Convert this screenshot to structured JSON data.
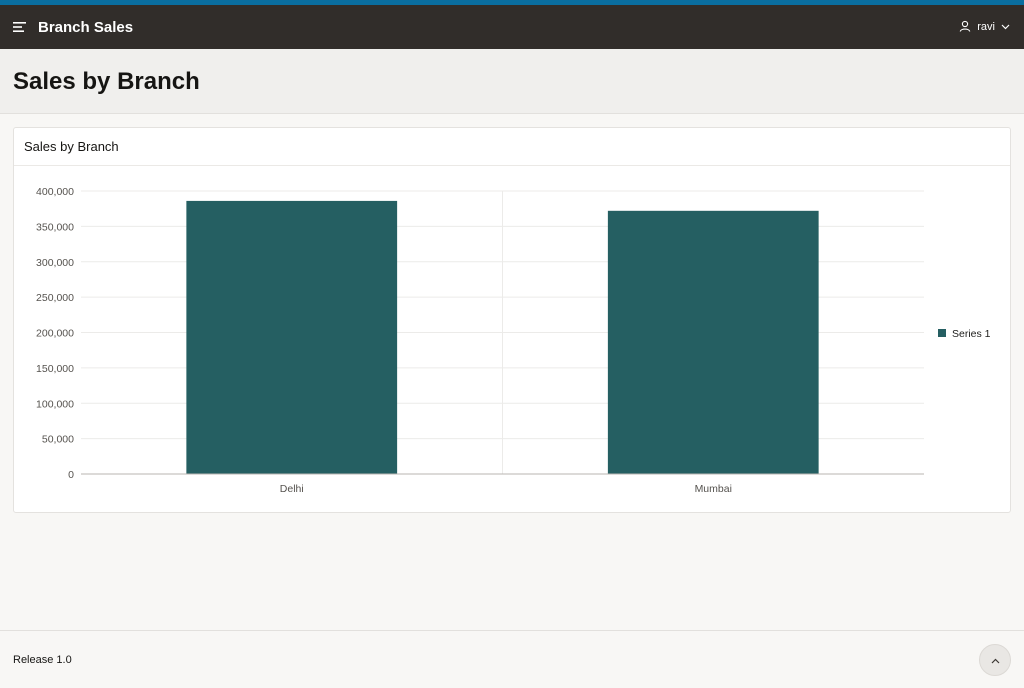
{
  "header": {
    "app_title": "Branch Sales",
    "menu_icon": "hamburger-menu-icon",
    "user": {
      "name": "ravi",
      "icon": "user-icon",
      "caret_icon": "chevron-down-icon"
    }
  },
  "colors": {
    "accent": "#0a6ea0",
    "header_bg": "#312d2a",
    "bar": "#255f62"
  },
  "page": {
    "title": "Sales by Branch"
  },
  "region": {
    "title": "Sales by Branch"
  },
  "chart_data": {
    "type": "bar",
    "title": "",
    "categories": [
      "Delhi",
      "Mumbai"
    ],
    "series": [
      {
        "name": "Series 1",
        "values": [
          386000,
          372000
        ],
        "color": "#255f62"
      }
    ],
    "ylim": [
      0,
      400000
    ],
    "yticks": [
      0,
      50000,
      100000,
      150000,
      200000,
      250000,
      300000,
      350000,
      400000
    ],
    "ytick_labels": [
      "0",
      "50,000",
      "100,000",
      "150,000",
      "200,000",
      "250,000",
      "300,000",
      "350,000",
      "400,000"
    ],
    "xlabel": "",
    "ylabel": "",
    "grid": true,
    "legend": "right"
  },
  "footer": {
    "release": "Release 1.0",
    "top_button_icon": "chevron-up-icon"
  }
}
